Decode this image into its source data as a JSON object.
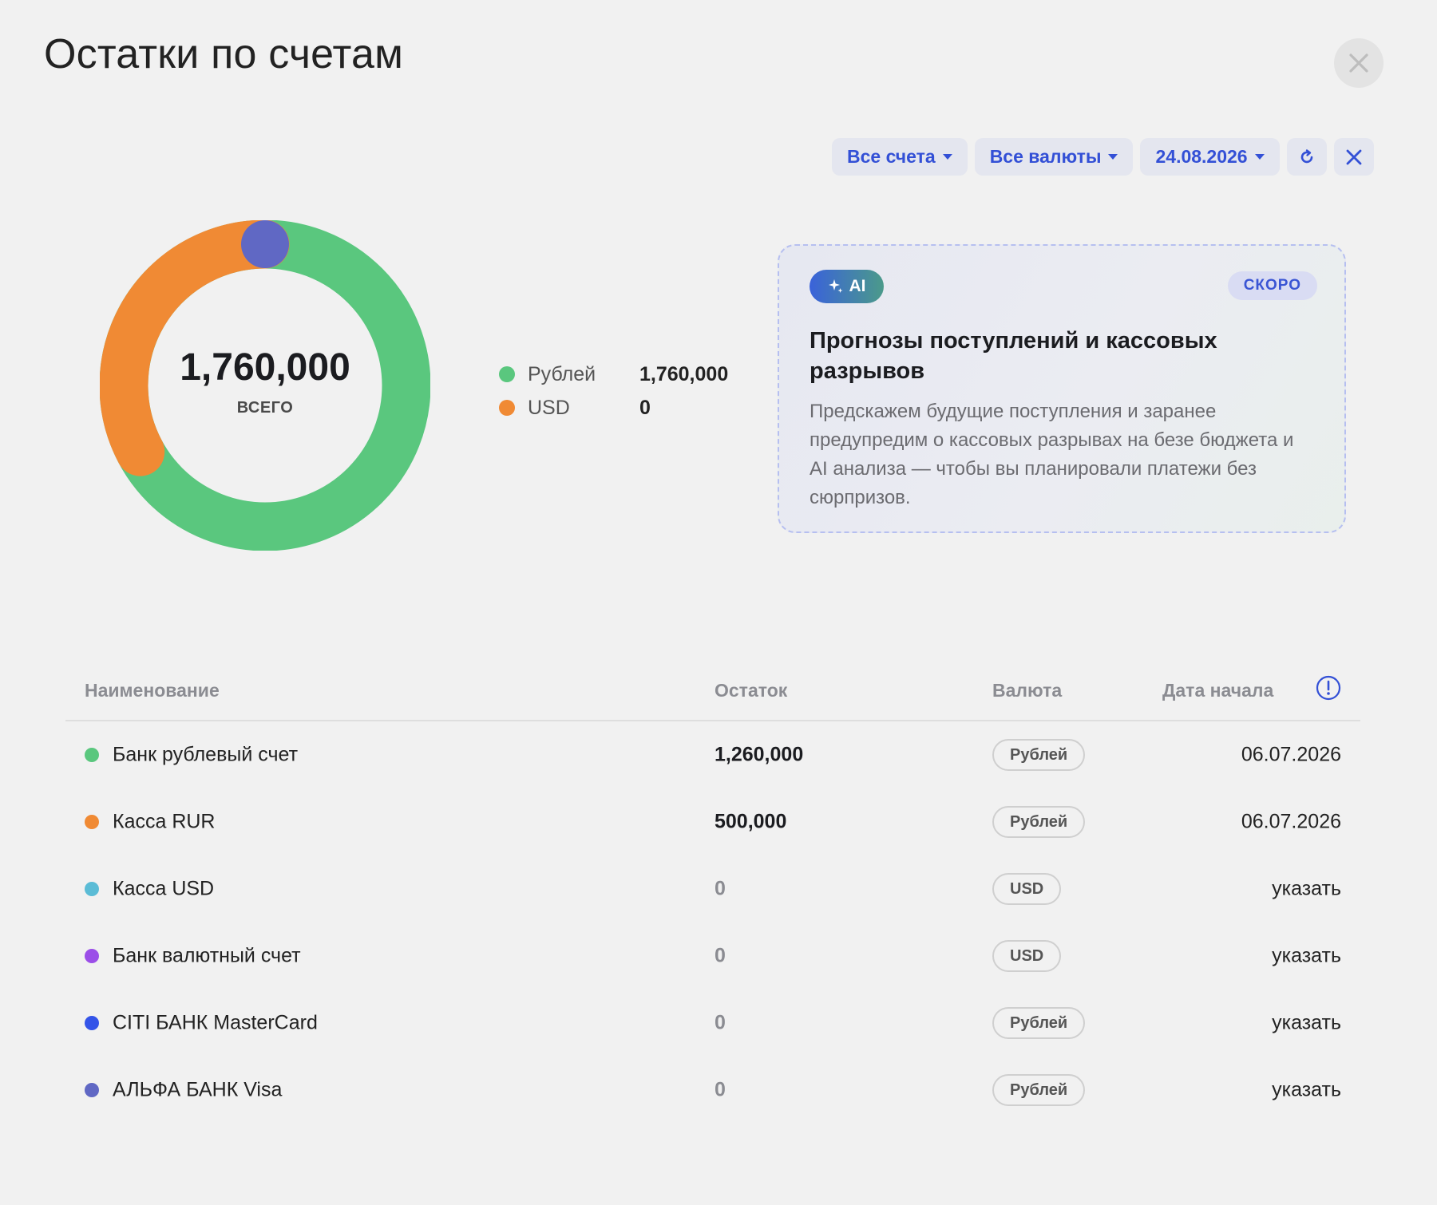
{
  "page": {
    "title": "Остатки по счетам"
  },
  "filters": {
    "accounts_label": "Все счета",
    "currencies_label": "Все валюты",
    "date_label": "24.08.2026"
  },
  "colors": {
    "rub": "#5ac77e",
    "usd": "#f08a34",
    "marker": "#6068c4",
    "accent": "#3350d6"
  },
  "summary": {
    "total": "1,760,000",
    "total_label": "ВСЕГО"
  },
  "chart_data": {
    "type": "pie",
    "categories": [
      "Рублей",
      "USD"
    ],
    "values": [
      1760000,
      0
    ]
  },
  "legend": [
    {
      "name": "Рублей",
      "value": "1,760,000",
      "color": "#5ac77e"
    },
    {
      "name": "USD",
      "value": "0",
      "color": "#f08a34"
    }
  ],
  "ai_card": {
    "badge": "AI",
    "status": "СКОРО",
    "title": "Прогнозы поступлений и кассовых разрывов",
    "description": "Предскажем будущие поступления и заранее предупредим о кассовых разрывах на безе бюджета и AI анализа — чтобы вы планировали платежи без сюрпризов."
  },
  "table": {
    "headers": {
      "name": "Наименование",
      "balance": "Остаток",
      "currency": "Валюта",
      "start_date": "Дата начала"
    },
    "rows": [
      {
        "name": "Банк рублевый счет",
        "balance": "1,260,000",
        "currency": "Рублей",
        "start_date": "06.07.2026",
        "color": "#5ac77e"
      },
      {
        "name": "Касса RUR",
        "balance": "500,000",
        "currency": "Рублей",
        "start_date": "06.07.2026",
        "color": "#f08a34"
      },
      {
        "name": "Касса USD",
        "balance": "0",
        "currency": "USD",
        "start_date": "указать",
        "color": "#5bbcd6"
      },
      {
        "name": "Банк валютный счет",
        "balance": "0",
        "currency": "USD",
        "start_date": "указать",
        "color": "#9b4ee8"
      },
      {
        "name": "CITI БАНК MasterCard",
        "balance": "0",
        "currency": "Рублей",
        "start_date": "указать",
        "color": "#3454e8"
      },
      {
        "name": "АЛЬФА БАНК Visa",
        "balance": "0",
        "currency": "Рублей",
        "start_date": "указать",
        "color": "#6068c4"
      }
    ]
  }
}
